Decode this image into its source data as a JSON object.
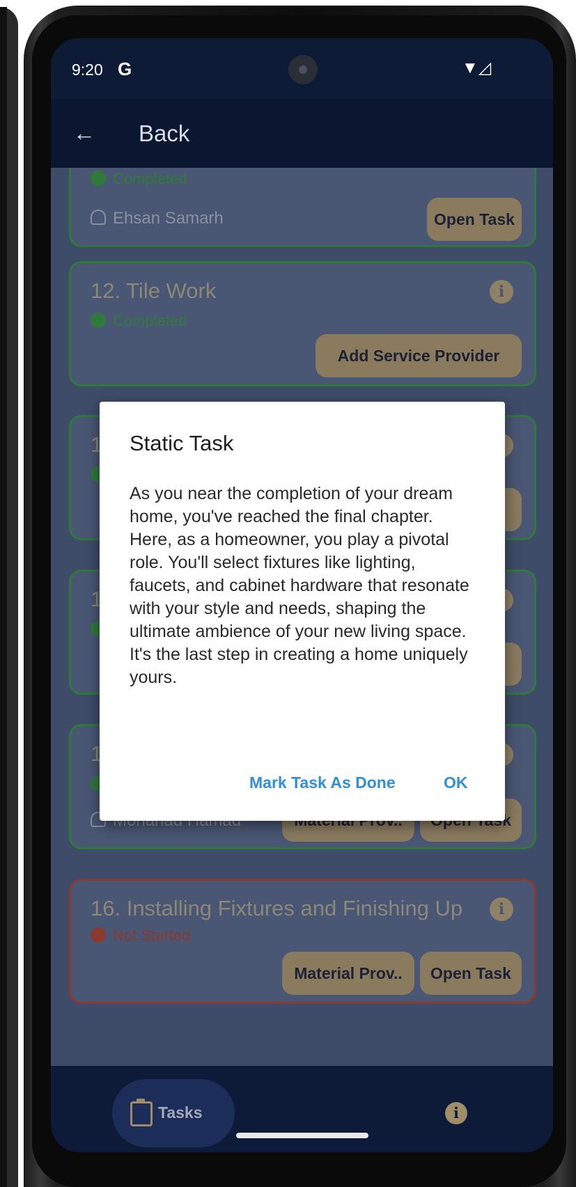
{
  "status_bar": {
    "time": "9:20",
    "carrier_mark": "G",
    "icons": "▼◿"
  },
  "app_bar": {
    "back_icon": "←",
    "back_label": "Back"
  },
  "cards": [
    {
      "status": "Completed",
      "person": "Ehsan Samarh",
      "button": "Open Task"
    },
    {
      "title": "12. Tile Work",
      "status": "Completed",
      "button": "Add Service Provider"
    },
    {
      "title_partial": "1"
    },
    {
      "title_partial": "1"
    },
    {
      "title_partial": "1",
      "person": "Mohanad Hamad",
      "buttons": [
        "Material Prov..",
        "Open Task"
      ]
    },
    {
      "title": "16. Installing Fixtures and Finishing Up",
      "status": "Not Started",
      "buttons": [
        "Material Prov..",
        "Open Task"
      ]
    }
  ],
  "dialog": {
    "title": "Static Task",
    "body": "As you near the completion of your dream home, you've reached the final chapter. Here, as a homeowner, you play a pivotal role. You'll select fixtures like lighting, faucets, and cabinet hardware that resonate with your style and needs, shaping the ultimate ambience of your new living space. It's the last step in creating a home uniquely yours.",
    "mark_done": "Mark Task As Done",
    "ok": "OK"
  },
  "bottom_nav": {
    "tasks_label": "Tasks",
    "info_icon": "i"
  },
  "colors": {
    "screen_bg": "#0d1a33",
    "card_border_completed": "#2f7a3a",
    "card_border_not_started": "#8a3a2e",
    "button_bg": "#8a7b5f",
    "dialog_button": "#2f8fd8"
  }
}
